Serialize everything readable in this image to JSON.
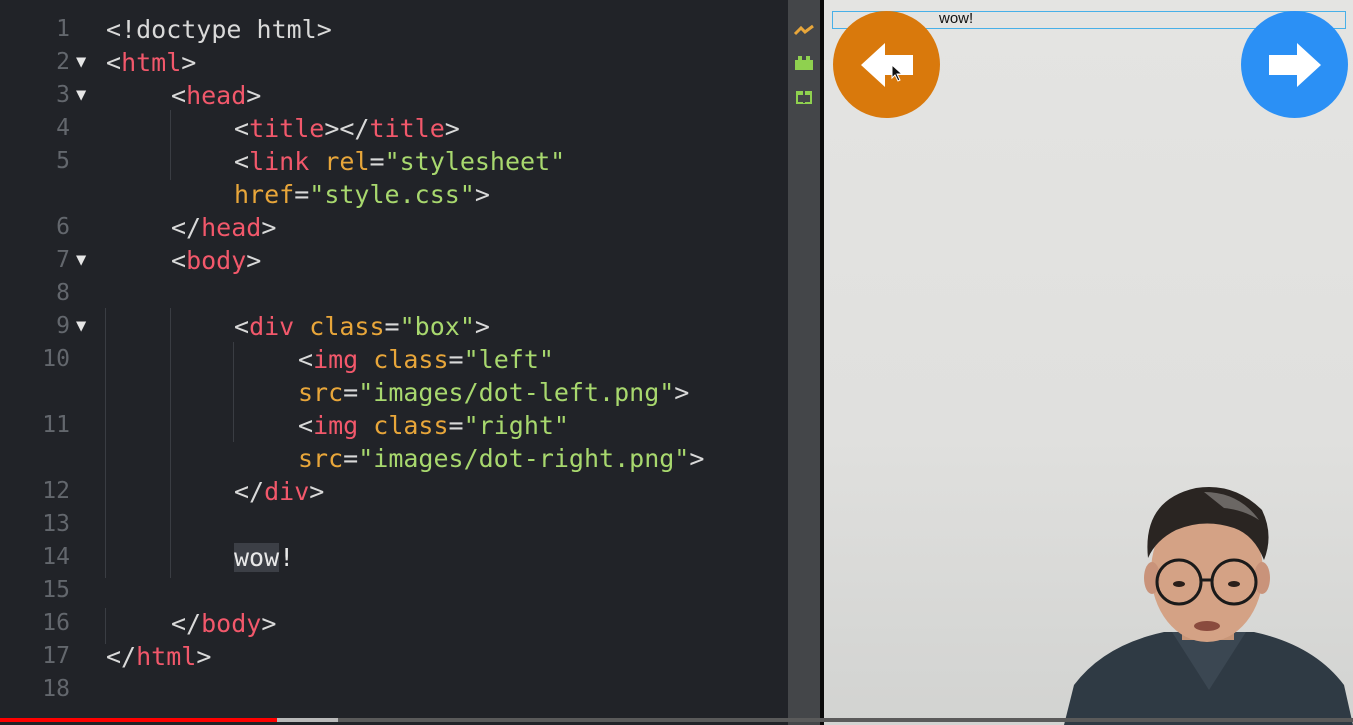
{
  "editor": {
    "lines": [
      {
        "num": "1",
        "fold": ""
      },
      {
        "num": "2",
        "fold": "▼"
      },
      {
        "num": "3",
        "fold": "▼"
      },
      {
        "num": "4",
        "fold": ""
      },
      {
        "num": "5",
        "fold": ""
      },
      {
        "num": "",
        "fold": ""
      },
      {
        "num": "6",
        "fold": ""
      },
      {
        "num": "7",
        "fold": "▼"
      },
      {
        "num": "8",
        "fold": ""
      },
      {
        "num": "9",
        "fold": "▼"
      },
      {
        "num": "10",
        "fold": ""
      },
      {
        "num": "",
        "fold": ""
      },
      {
        "num": "11",
        "fold": ""
      },
      {
        "num": "",
        "fold": ""
      },
      {
        "num": "12",
        "fold": ""
      },
      {
        "num": "13",
        "fold": ""
      },
      {
        "num": "14",
        "fold": ""
      },
      {
        "num": "15",
        "fold": ""
      },
      {
        "num": "16",
        "fold": ""
      },
      {
        "num": "17",
        "fold": ""
      },
      {
        "num": "18",
        "fold": ""
      }
    ],
    "tokens": {
      "l1": [
        "<!doctype html>"
      ],
      "l2": [
        "<",
        "html",
        ">"
      ],
      "l3": [
        "<",
        "head",
        ">"
      ],
      "l4": [
        "<",
        "title",
        "></",
        "title",
        ">"
      ],
      "l5": [
        "<",
        "link",
        " ",
        "rel",
        "=",
        "\"stylesheet\""
      ],
      "l5b": [
        "href",
        "=",
        "\"style.css\"",
        ">"
      ],
      "l6": [
        "</",
        "head",
        ">"
      ],
      "l7": [
        "<",
        "body",
        ">"
      ],
      "l9": [
        "<",
        "div",
        " ",
        "class",
        "=",
        "\"box\"",
        ">"
      ],
      "l10": [
        "<",
        "img",
        " ",
        "class",
        "=",
        "\"left\""
      ],
      "l10b": [
        "src",
        "=",
        "\"images/dot-left.png\"",
        ">"
      ],
      "l11": [
        "<",
        "img",
        " ",
        "class",
        "=",
        "\"right\""
      ],
      "l11b": [
        "src",
        "=",
        "\"images/dot-right.png\"",
        ">"
      ],
      "l12": [
        "</",
        "div",
        ">"
      ],
      "l14": [
        "wow",
        "!"
      ],
      "l16": [
        "</",
        "body",
        ">"
      ],
      "l17": [
        "</",
        "html",
        ">"
      ]
    }
  },
  "toolbar": {
    "icons": [
      "live-preview-icon",
      "extensions-icon",
      "gift-icon"
    ],
    "colors": [
      "#e8a63a",
      "#8fd14f",
      "#8fd14f"
    ]
  },
  "preview": {
    "text": "wow!",
    "left_arrow_color": "#d9790c",
    "right_arrow_color": "#2b90f5"
  },
  "video": {
    "progress_played": 0.205,
    "progress_buffered": 0.25,
    "played_color": "#ff0000"
  }
}
